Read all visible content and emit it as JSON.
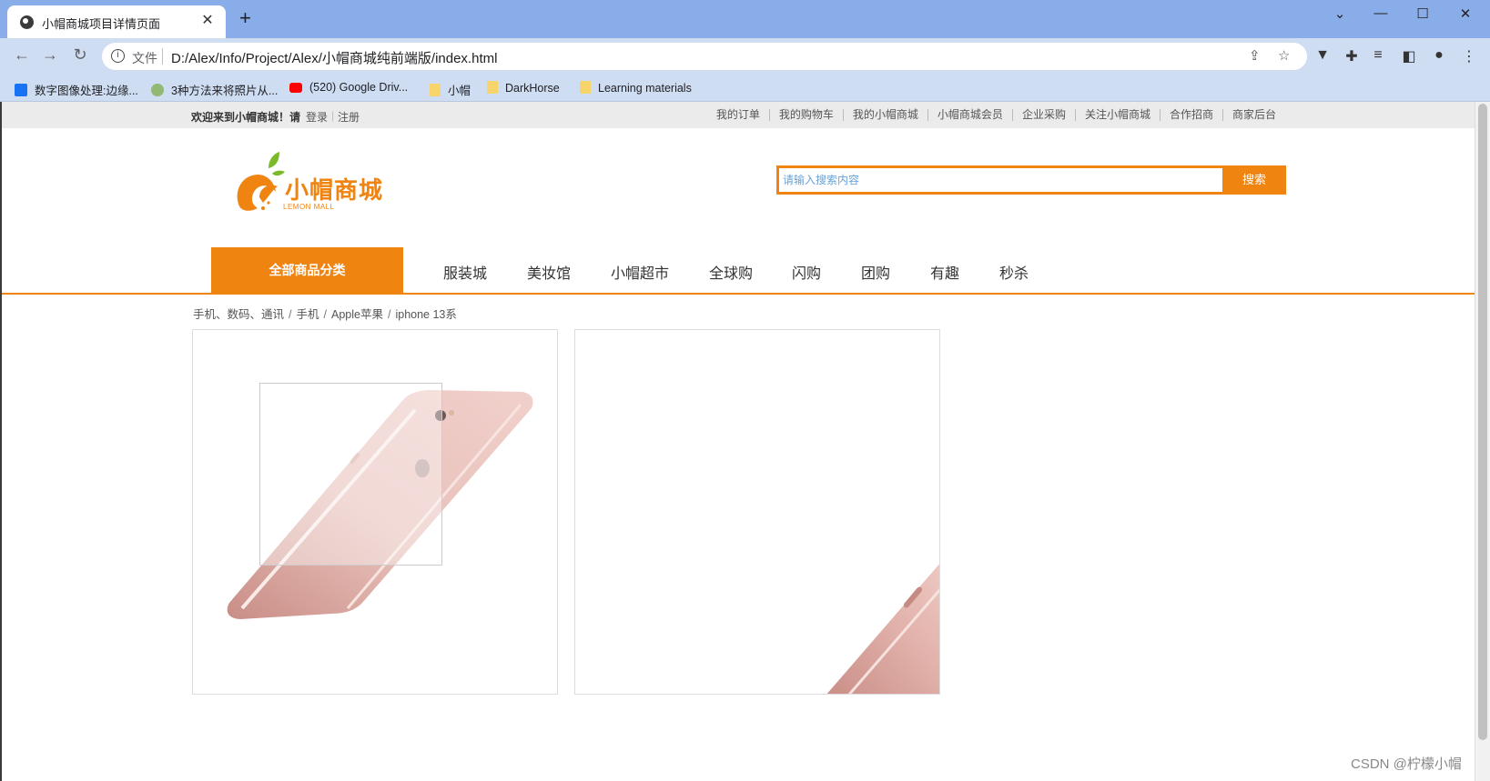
{
  "browser": {
    "tab_title": "小帽商城项目详情页面",
    "url_scheme": "文件",
    "url": "D:/Alex/Info/Project/Alex/小帽商城纯前端版/index.html",
    "bookmarks": [
      {
        "label": "数字图像处理:边缘...",
        "icon": "zhihu-icon",
        "color": "#1772f6"
      },
      {
        "label": "3种方法来将照片从...",
        "icon": "wikihow-icon",
        "color": "#93b874"
      },
      {
        "label": "(520) Google Driv...",
        "icon": "youtube-icon",
        "color": "#ff0000"
      },
      {
        "label": "小帽",
        "icon": "folder-icon",
        "color": "#f7d56b"
      },
      {
        "label": "DarkHorse",
        "icon": "folder-icon",
        "color": "#f7d56b"
      },
      {
        "label": "Learning materials",
        "icon": "folder-icon",
        "color": "#f7d56b"
      }
    ]
  },
  "shortcut": {
    "welcome": "欢迎来到小帽商城！请",
    "login": "登录",
    "register": "注册",
    "links": [
      "我的订单",
      "我的购物车",
      "我的小帽商城",
      "小帽商城会员",
      "企业采购",
      "关注小帽商城",
      "合作招商",
      "商家后台"
    ]
  },
  "logo": {
    "brand": "小帽商城",
    "sub": "LEMON MALL"
  },
  "search": {
    "placeholder": "请输入搜索内容",
    "button": "搜索"
  },
  "nav": {
    "all_categories": "全部商品分类",
    "items": [
      "服装城",
      "美妆馆",
      "小帽超市",
      "全球购",
      "闪购",
      "团购",
      "有趣",
      "秒杀"
    ]
  },
  "breadcrumb": [
    "手机、数码、通讯",
    "手机",
    "Apple苹果",
    "iphone 13系"
  ],
  "watermark": "CSDN @柠檬小帽",
  "colors": {
    "accent": "#ef8410",
    "chrome": "#89ade8"
  }
}
